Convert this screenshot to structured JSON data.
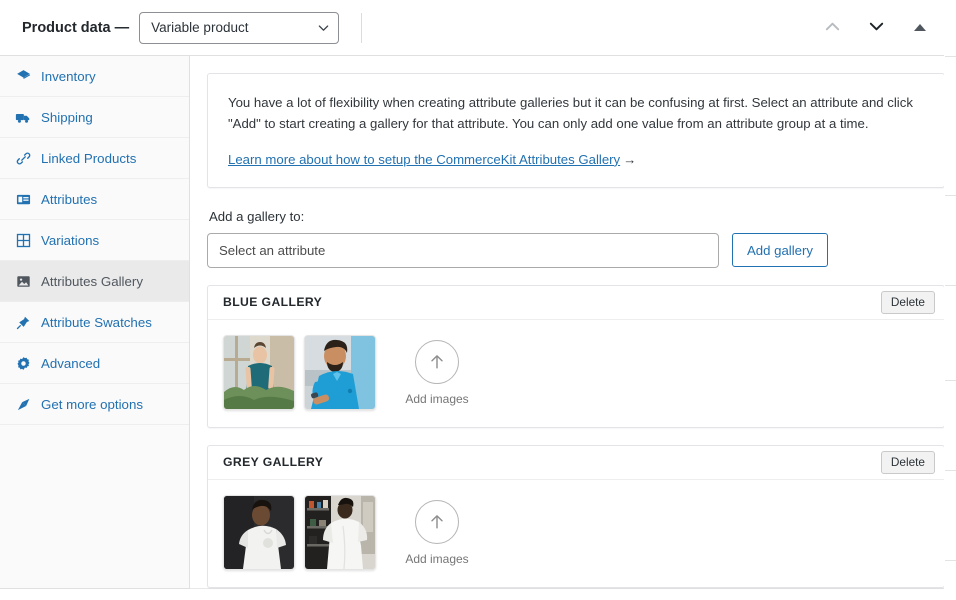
{
  "header": {
    "title": "Product data —",
    "product_type": "Variable product",
    "chevron_down_icon": "chevron-down-icon",
    "collapse_up_icon": "chevron-up-icon",
    "expand_down_icon": "chevron-down-icon",
    "toggle_icon": "triangle-up-icon"
  },
  "sidebar": {
    "items": [
      {
        "label": "Inventory",
        "icon": "archive-icon",
        "active": false
      },
      {
        "label": "Shipping",
        "icon": "truck-icon",
        "active": false
      },
      {
        "label": "Linked Products",
        "icon": "link-icon",
        "active": false
      },
      {
        "label": "Attributes",
        "icon": "list-view-icon",
        "active": false
      },
      {
        "label": "Variations",
        "icon": "grid-icon",
        "active": false
      },
      {
        "label": "Attributes Gallery",
        "icon": "image-icon",
        "active": true
      },
      {
        "label": "Attribute Swatches",
        "icon": "pin-icon",
        "active": false
      },
      {
        "label": "Advanced",
        "icon": "gear-icon",
        "active": false
      },
      {
        "label": "Get more options",
        "icon": "plugin-icon",
        "active": false
      }
    ]
  },
  "notice": {
    "text": "You have a lot of flexibility when creating attribute galleries but it can be confusing at first. Select an attribute and click \"Add\" to start creating a gallery for that attribute. You can only add one value from an attribute group at a time.",
    "link_text": "Learn more about how to setup the CommerceKit Attributes Gallery",
    "link_arrow": "→"
  },
  "add_gallery": {
    "label": "Add a gallery to:",
    "select_placeholder": "Select an attribute",
    "button_label": "Add gallery"
  },
  "galleries": [
    {
      "title": "BLUE GALLERY",
      "delete_label": "Delete",
      "add_images_label": "Add images",
      "upload_icon": "arrow-up-icon",
      "images": [
        {
          "alt": "man in teal t-shirt outdoors",
          "theme": "teal-outdoor"
        },
        {
          "alt": "man in blue polo shirt",
          "theme": "blue-polo"
        }
      ]
    },
    {
      "title": "GREY GALLERY",
      "delete_label": "Delete",
      "add_images_label": "Add images",
      "upload_icon": "arrow-up-icon",
      "images": [
        {
          "alt": "man in white tee on dark background",
          "theme": "white-dark"
        },
        {
          "alt": "back view of white oversized tee in room",
          "theme": "white-room"
        }
      ]
    }
  ],
  "colors": {
    "link": "#2271b1",
    "sidebar_bg": "#fafafa",
    "active_bg": "#eaeaea"
  }
}
